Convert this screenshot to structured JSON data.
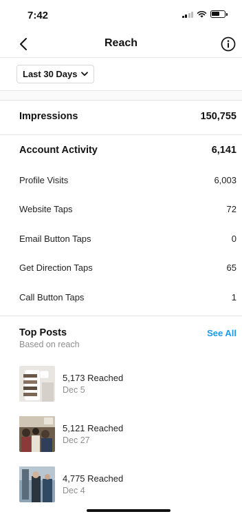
{
  "status_bar": {
    "time": "7:42"
  },
  "nav": {
    "title": "Reach"
  },
  "filter": {
    "range_label": "Last 30 Days"
  },
  "impressions": {
    "label": "Impressions",
    "value": "150,755"
  },
  "account_activity": {
    "label": "Account Activity",
    "value": "6,141",
    "items": [
      {
        "label": "Profile Visits",
        "value": "6,003"
      },
      {
        "label": "Website Taps",
        "value": "72"
      },
      {
        "label": "Email Button Taps",
        "value": "0"
      },
      {
        "label": "Get Direction Taps",
        "value": "65"
      },
      {
        "label": "Call Button Taps",
        "value": "1"
      }
    ]
  },
  "top_posts": {
    "title": "Top Posts",
    "subtitle": "Based on reach",
    "see_all_label": "See All",
    "posts": [
      {
        "reached": "5,173 Reached",
        "date": "Dec 5"
      },
      {
        "reached": "5,121 Reached",
        "date": "Dec 27"
      },
      {
        "reached": "4,775 Reached",
        "date": "Dec 4"
      }
    ]
  }
}
